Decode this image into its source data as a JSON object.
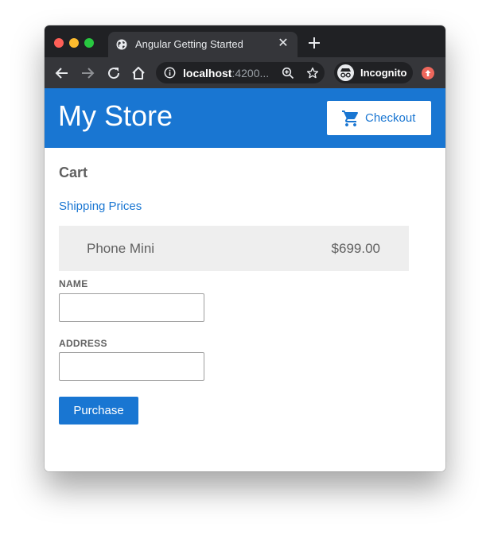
{
  "browser": {
    "tab_title": "Angular Getting Started",
    "url_host": "localhost",
    "url_port_truncated": ":4200...",
    "profile_label": "Incognito"
  },
  "header": {
    "store_title": "My Store",
    "checkout_label": "Checkout"
  },
  "cart": {
    "heading": "Cart",
    "shipping_link": "Shipping Prices",
    "items": [
      {
        "name": "Phone Mini",
        "price": "$699.00"
      }
    ]
  },
  "form": {
    "name_label": "NAME",
    "name_value": "",
    "address_label": "ADDRESS",
    "address_value": "",
    "submit_label": "Purchase"
  },
  "colors": {
    "primary": "#1976d2",
    "browser_frame": "#202124",
    "browser_toolbar": "#35363a",
    "item_background": "#eeeeee",
    "text_muted": "#616161"
  }
}
